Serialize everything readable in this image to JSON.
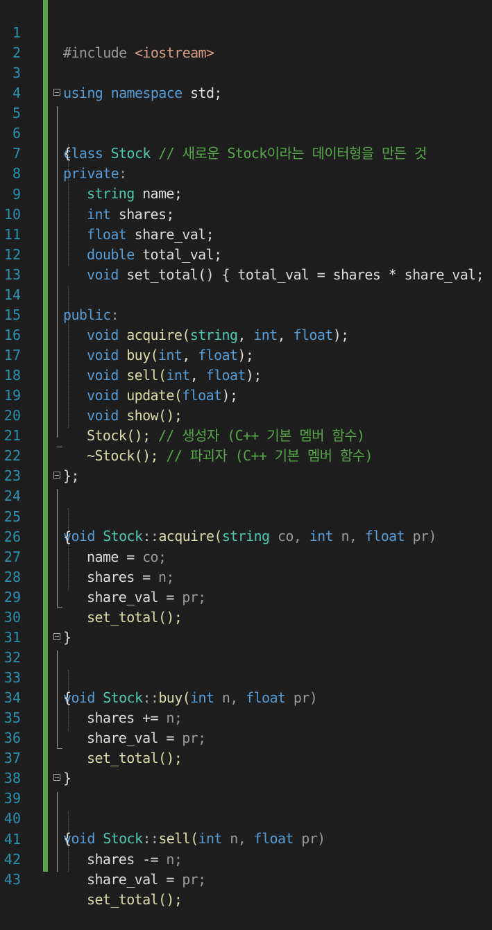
{
  "editor": {
    "line_numbers": [
      "1",
      "2",
      "3",
      "4",
      "5",
      "6",
      "7",
      "8",
      "9",
      "10",
      "11",
      "12",
      "13",
      "14",
      "15",
      "16",
      "17",
      "18",
      "19",
      "20",
      "21",
      "22",
      "23",
      "24",
      "25",
      "26",
      "27",
      "28",
      "29",
      "30",
      "31",
      "32",
      "33",
      "34",
      "35",
      "36",
      "37",
      "38",
      "39",
      "40",
      "41",
      "42",
      "43"
    ],
    "code": {
      "l1": {
        "a": "#include ",
        "b": "<iostream>"
      },
      "l3": {
        "a": "using namespace ",
        "b": "std;"
      },
      "l5": {
        "a": "class ",
        "b": "Stock",
        "c": " // 새로운 Stock이라는 데이터형을 만든 것"
      },
      "l6": "{",
      "l7": {
        "a": "private",
        "b": ":"
      },
      "l8": {
        "a": "string",
        "b": " name;"
      },
      "l9": {
        "a": "int",
        "b": " shares;"
      },
      "l10": {
        "a": "float",
        "b": " share_val;"
      },
      "l11": {
        "a": "double",
        "b": " total_val;"
      },
      "l12": {
        "a": "void",
        "b": " set_total() { total_val = shares * share_val; }"
      },
      "l14": {
        "a": "public",
        "b": ":"
      },
      "l15": {
        "a": "void",
        "b": " acquire(",
        "c": "string",
        "d": ", ",
        "e": "int",
        "f": ", ",
        "g": "float",
        "h": ");"
      },
      "l16": {
        "a": "void",
        "b": " buy(",
        "c": "int",
        "d": ", ",
        "e": "float",
        "f": ");"
      },
      "l17": {
        "a": "void",
        "b": " sell(",
        "c": "int",
        "d": ", ",
        "e": "float",
        "f": ");"
      },
      "l18": {
        "a": "void",
        "b": " update(",
        "c": "float",
        "d": ");"
      },
      "l19": {
        "a": "void",
        "b": " show();"
      },
      "l20": {
        "a": "Stock();",
        "b": " // 생성자 (C++ 기본 멤버 함수)"
      },
      "l21": {
        "a": "~Stock();",
        "b": " // 파괴자 (C++ 기본 멤버 함수)"
      },
      "l22": "};",
      "l24": {
        "a": "void",
        "b": " Stock",
        "c": "::",
        "d": "acquire(",
        "e": "string",
        "f": " co, ",
        "g": "int",
        "h": " n, ",
        "i": "float",
        "j": " pr)"
      },
      "l25": "{",
      "l26": {
        "a": "name = ",
        "b": "co;"
      },
      "l27": {
        "a": "shares = ",
        "b": "n;"
      },
      "l28": {
        "a": "share_val = ",
        "b": "pr;"
      },
      "l29": "set_total();",
      "l30": "}",
      "l32": {
        "a": "void",
        "b": " Stock",
        "c": "::",
        "d": "buy(",
        "e": "int",
        "f": " n, ",
        "g": "float",
        "h": " pr)"
      },
      "l33": "{",
      "l34": {
        "a": "shares += ",
        "b": "n;"
      },
      "l35": {
        "a": "share_val = ",
        "b": "pr;"
      },
      "l36": "set_total();",
      "l37": "}",
      "l39": {
        "a": "void",
        "b": " Stock",
        "c": "::",
        "d": "sell(",
        "e": "int",
        "f": " n, ",
        "g": "float",
        "h": " pr)"
      },
      "l40": "{",
      "l41": {
        "a": "shares -= ",
        "b": "n;"
      },
      "l42": {
        "a": "share_val = ",
        "b": "pr;"
      },
      "l43": "set_total();"
    },
    "colors": {
      "background": "#1e1e1e",
      "line_number": "#2b91af",
      "keyword": "#569cd6",
      "type": "#4ec9b0",
      "comment": "#57a64a",
      "change_bar": "#57a64a"
    }
  }
}
